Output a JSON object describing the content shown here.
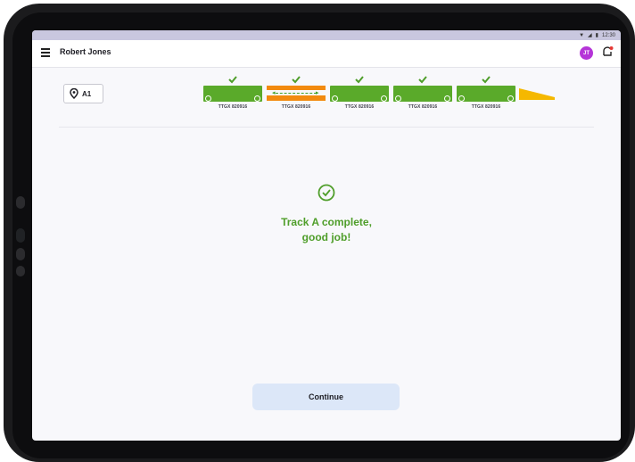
{
  "status_bar": {
    "time": "12:30",
    "icons": [
      "wifi-icon",
      "signal-icon",
      "battery-icon"
    ]
  },
  "app_bar": {
    "user_name": "Robert Jones",
    "avatar_initials": "JT",
    "avatar_color": "#b535d8"
  },
  "location": {
    "label": "A1"
  },
  "train": {
    "cars": [
      {
        "label": "TTGX 820916",
        "checked": true,
        "selected": false
      },
      {
        "label": "TTGX 820916",
        "checked": true,
        "selected": true
      },
      {
        "label": "TTGX 820916",
        "checked": true,
        "selected": false
      },
      {
        "label": "TTGX 820916",
        "checked": true,
        "selected": false
      },
      {
        "label": "TTGX 820916",
        "checked": true,
        "selected": false
      }
    ]
  },
  "completion": {
    "line1": "Track A complete,",
    "line2": "good job!"
  },
  "continue_label": "Continue",
  "colors": {
    "accent_green": "#5aaa2a",
    "selected_orange": "#f28a0f",
    "locomotive_yellow": "#f5b800",
    "button_bg": "#dce7f8"
  }
}
